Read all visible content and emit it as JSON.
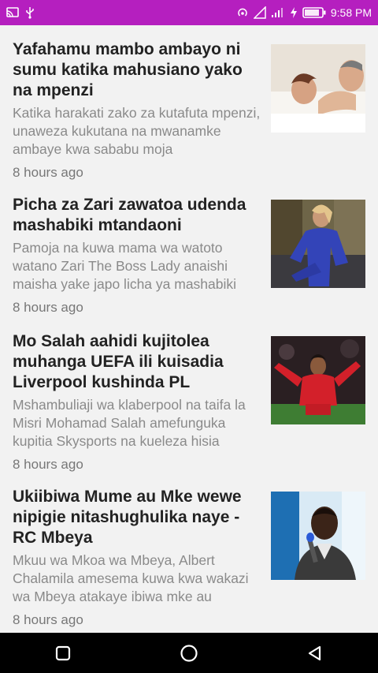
{
  "status_bar": {
    "time": "9:58 PM",
    "accent_color": "#b51fbf",
    "left_icons": [
      "cast-icon",
      "usb-icon"
    ],
    "right_icons": [
      "hotspot-icon",
      "signal-icon",
      "wifi-bars-icon",
      "charging-icon",
      "battery-icon"
    ]
  },
  "articles": [
    {
      "title": "Yafahamu mambo ambayo ni sumu katika mahusiano yako na mpenzi",
      "summary": "Katika harakati zako za kutafuta mpenzi, unaweza kukutana na mwanamke ambaye kwa sababu moja",
      "time": "8 hours ago",
      "image": "couple-bed-photo"
    },
    {
      "title": "Picha za Zari zawatoa udenda mashabiki mtandaoni",
      "summary": "Pamoja na kuwa mama wa watoto watano Zari The Boss Lady anaishi maisha yake japo licha ya mashabiki",
      "time": "8 hours ago",
      "image": "woman-blue-outfit-photo"
    },
    {
      "title": "Mo Salah aahidi kujitolea muhanga UEFA ili kuisadia Liverpool kushinda PL",
      "summary": "Mshambuliaji wa klaberpool na taifa la Misri Mohamad Salah amefunguka kupitia Skysports na kueleza hisia",
      "time": "8 hours ago",
      "image": "footballer-celebrating-photo"
    },
    {
      "title": "Ukiibiwa Mume au Mke wewe nipigie nitashughulika naye - RC Mbeya",
      "summary": "Mkuu wa Mkoa wa Mbeya, Albert Chalamila amesema kuwa kwa wakazi wa Mbeya atakaye ibiwa mke au",
      "time": "8 hours ago",
      "image": "man-speaking-microphone-photo"
    }
  ],
  "nav_bar": {
    "buttons": [
      "recent-apps-icon",
      "home-icon",
      "back-icon"
    ]
  }
}
